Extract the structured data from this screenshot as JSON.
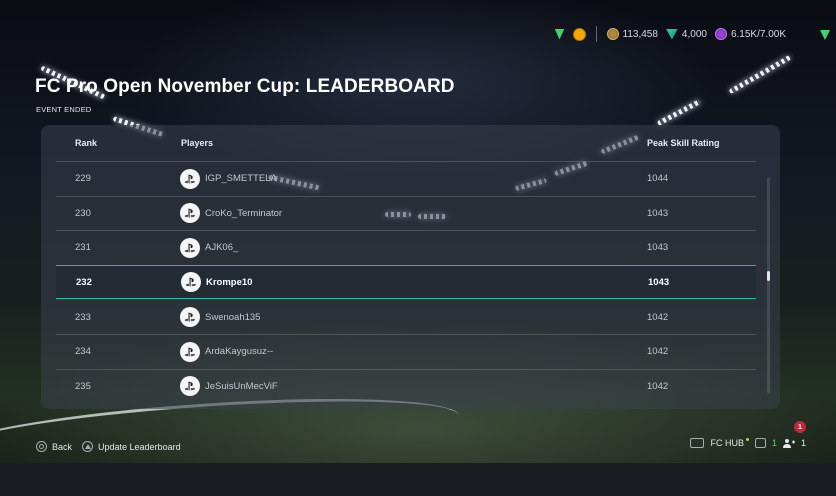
{
  "header": {
    "title": "FC Pro Open November Cup: LEADERBOARD",
    "status": "EVENT ENDED"
  },
  "currencies": {
    "coins": "113,458",
    "fc_points": "4,000",
    "sp": "6.15K/7.00K"
  },
  "leaderboard": {
    "columns": {
      "rank": "Rank",
      "players": "Players",
      "rating": "Peak Skill Rating"
    },
    "rows": [
      {
        "rank": "229",
        "player": "IGP_SMETTELA",
        "rating": "1044",
        "platform": "playstation-icon"
      },
      {
        "rank": "230",
        "player": "CroKo_Terminator",
        "rating": "1043",
        "platform": "playstation-icon"
      },
      {
        "rank": "231",
        "player": "AJK06_",
        "rating": "1043",
        "platform": "playstation-icon"
      },
      {
        "rank": "232",
        "player": "Krompe10",
        "rating": "1043",
        "platform": "playstation-icon",
        "selected": true
      },
      {
        "rank": "233",
        "player": "Swenoah135",
        "rating": "1042",
        "platform": "playstation-icon"
      },
      {
        "rank": "234",
        "player": "ArdaKaygusuz--",
        "rating": "1042",
        "platform": "playstation-icon"
      },
      {
        "rank": "235",
        "player": "JeSuisUnMecViF",
        "rating": "1042",
        "platform": "playstation-icon"
      }
    ]
  },
  "footer": {
    "back_label": "Back",
    "update_label": "Update Leaderboard",
    "hub_label": "FC HUB",
    "squad_count": "1",
    "friends_count": "1",
    "notification_count": "1"
  },
  "colors": {
    "accent_teal": "#2fb6a6",
    "notification_red": "#c0283e",
    "online_green": "#56d26a"
  }
}
